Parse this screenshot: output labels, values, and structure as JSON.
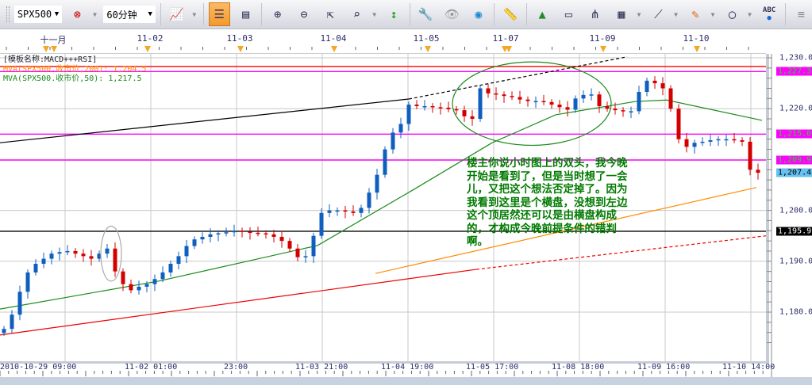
{
  "toolbar": {
    "symbol": "SPX500",
    "timeframe": "60分钟",
    "abc_label": "ABC",
    "icons": [
      "chart-link-icon",
      "chart-type-icon",
      "bar-mode-icon",
      "data-window-icon",
      "zoom-in-icon",
      "zoom-out-icon",
      "cursor-icon",
      "zoom-area-icon",
      "fit-icon",
      "properties-icon",
      "visibility-icon",
      "globe-icon",
      "ruler-icon",
      "add-image-icon",
      "compare-icon",
      "pitchfork-icon",
      "indicator-icon",
      "fan-icon",
      "pencil-icon",
      "ellipse-icon",
      "text-icon",
      "menu-icon"
    ]
  },
  "top_axis": {
    "labels": [
      {
        "t": "十一月",
        "i": 6.2
      },
      {
        "t": "11-02",
        "i": 18.4
      },
      {
        "t": "11-03",
        "i": 29.7
      },
      {
        "t": "11-04",
        "i": 41.5
      },
      {
        "t": "11-05",
        "i": 53.2
      },
      {
        "t": "11-07",
        "i": 63.2
      },
      {
        "t": "11-09",
        "i": 75.4
      },
      {
        "t": "11-10",
        "i": 87.2
      }
    ],
    "markers": [
      5.3,
      6.3,
      18.1,
      29.8,
      41.6,
      53.4,
      63.1,
      63.6,
      75.5,
      87.3
    ]
  },
  "legend": {
    "template": "[模板名称:MACD+++RSI]",
    "ma200": "MVA(SPX500.收市价,200): 1,204.5",
    "ma50": "MVA(SPX500.收市价,50): 1,217.5"
  },
  "bottom_axis": [
    "2010-10-29 09:00",
    "11-02 01:00",
    "23:00",
    "11-03 21:00",
    "11-04 19:00",
    "11-05 17:00",
    "11-08 18:00",
    "11-09 16:00",
    "11-10 14:00"
  ],
  "price_axis": {
    "ticks": [
      "1,230.0",
      "1,220.0",
      "1,210.0",
      "1,200.0",
      "1,190.0",
      "1,180.0"
    ],
    "tick_values": [
      1230,
      1220,
      1210,
      1200,
      1190,
      1180
    ],
    "highlights": [
      {
        "label": "1,227.3",
        "value": 1227.3,
        "kind": "hl"
      },
      {
        "label": "1,215.0",
        "value": 1215.0,
        "kind": "hl"
      },
      {
        "label": "1,209.9",
        "value": 1209.9,
        "kind": "hl"
      },
      {
        "label": "1,207.4",
        "value": 1207.4,
        "kind": "cur"
      },
      {
        "label": "1,195.9",
        "value": 1195.9,
        "kind": "blk"
      }
    ]
  },
  "annotation": "楼主你说小时图上的双头，我今晚开始是看到了，但是当时想了一会儿，又把这个想法否定掉了。因为我看到这里是个横盘，没想到左边这个顶居然还可以是由横盘构成的，才构成今晚前提条件的错判啊。",
  "colors": {
    "up": "#0f5fbf",
    "down": "#d40000",
    "ma50": "#1a8a1a",
    "ma200": "#ff8c00",
    "hline_red": "#ff0000",
    "hline_magenta": "#ff00ff"
  },
  "chart_data": {
    "type": "candlestick",
    "symbol": "SPX500",
    "ylim": [
      1173.5,
      1231
    ],
    "closes": [
      1176.7,
      1179.5,
      1184,
      1187.8,
      1189.5,
      1190.5,
      1191.5,
      1191.8,
      1192,
      1191.5,
      1191,
      1190.5,
      1191.5,
      1192.5,
      1188,
      1185.5,
      1184.3,
      1185,
      1185.5,
      1186.5,
      1187.8,
      1189.5,
      1191,
      1193,
      1194.3,
      1194.8,
      1195.3,
      1195.5,
      1195.7,
      1196,
      1195.8,
      1195.6,
      1195.5,
      1195.3,
      1194.8,
      1194,
      1192.5,
      1190.8,
      1191,
      1195,
      1199.5,
      1200,
      1200,
      1199.8,
      1199.5,
      1200.5,
      1203.5,
      1207,
      1212,
      1215.3,
      1217,
      1220.8,
      1220.5,
      1220.5,
      1220.3,
      1220.2,
      1219.9,
      1219.7,
      1218.5,
      1218,
      1224,
      1223,
      1222.8,
      1222.5,
      1222.3,
      1221.8,
      1221.5,
      1221.5,
      1221.3,
      1220.8,
      1220.3,
      1219.8,
      1222,
      1222.7,
      1222.8,
      1220.5,
      1220,
      1219.7,
      1219.5,
      1219.5,
      1223.3,
      1225.5,
      1225,
      1224,
      1220,
      1214,
      1212.5,
      1213.3,
      1213.5,
      1213.8,
      1214,
      1214,
      1213.8,
      1213.5,
      1208,
      1207.4
    ],
    "ma50": [
      [
        -0.5,
        1180.6
      ],
      [
        19.5,
        1186.1
      ],
      [
        39.5,
        1193.1
      ],
      [
        51.5,
        1204
      ],
      [
        61.5,
        1213.3
      ],
      [
        69.5,
        1218.8
      ],
      [
        79.5,
        1221.4
      ],
      [
        83.5,
        1221.7
      ],
      [
        95.5,
        1217.7
      ]
    ],
    "ma200": [
      [
        46.8,
        1187.6
      ],
      [
        94.8,
        1204.5
      ]
    ],
    "hlines": [
      {
        "value": 1228.3,
        "color": "red"
      },
      {
        "value": 1227.3,
        "color": "magenta"
      },
      {
        "value": 1215.0,
        "color": "magenta"
      },
      {
        "value": 1209.9,
        "color": "magenta"
      },
      {
        "value": 1195.9,
        "color": "black"
      }
    ],
    "trendlines": [
      {
        "color": "black",
        "points": [
          [
            -0.5,
            1213.3
          ],
          [
            51,
            1221.9
          ]
        ],
        "dashed_to": [
          78.5,
          1230.2
        ]
      },
      {
        "color": "red",
        "points": [
          [
            -0.5,
            1175.5
          ],
          [
            59.5,
            1188.4
          ]
        ],
        "dashed_to": [
          96,
          1195
        ]
      }
    ],
    "ellipses": [
      {
        "color": "green",
        "center": [
          66.5,
          1221
        ],
        "radius_candles": 10,
        "radius_price": 8.2
      },
      {
        "color": "gray",
        "center": [
          13.5,
          1191.5
        ],
        "radius_candles": 1.3,
        "radius_price": 5.4
      }
    ]
  }
}
